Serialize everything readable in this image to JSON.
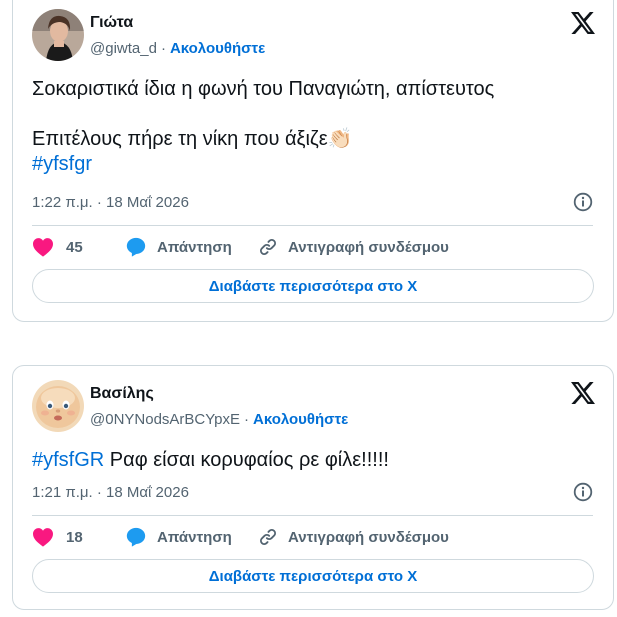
{
  "tweets": [
    {
      "name": "Γιώτα",
      "handle": "@giwta_d",
      "follow_label": "Ακολουθήστε",
      "text_line1": "Σοκαριστικά ίδια η φωνή του Παναγιώτη, απίστευτος",
      "text_line2": "Επιτέλους πήρε τη νίκη που άξιζε👏🏻",
      "hashtag": "#yfsfgr",
      "timestamp": "1:22 π.μ. · 18 Μαΐ 2026",
      "likes": "45",
      "reply_label": "Απάντηση",
      "copy_label": "Αντιγραφή συνδέσμου",
      "readmore_label": "Διαβάστε περισσότερα στο X"
    },
    {
      "name": "Βασίλης",
      "handle": "@0NYNodsArBCYpxE",
      "follow_label": "Ακολουθήστε",
      "hashtag": "#yfsfGR",
      "text": " Ραφ είσαι κορυφαίος ρε φίλε!!!!!",
      "timestamp": "1:21 π.μ. · 18 Μαΐ 2026",
      "likes": "18",
      "reply_label": "Απάντηση",
      "copy_label": "Αντιγραφή συνδέσμου",
      "readmore_label": "Διαβάστε περισσότερα στο X"
    }
  ],
  "colors": {
    "link": "#006fd6",
    "like": "#f91880",
    "reply": "#1d9bf0",
    "muted": "#536471",
    "border": "#cfd9de"
  },
  "icons": [
    "x-logo-icon",
    "info-icon",
    "heart-icon",
    "reply-bubble-icon",
    "link-icon"
  ]
}
